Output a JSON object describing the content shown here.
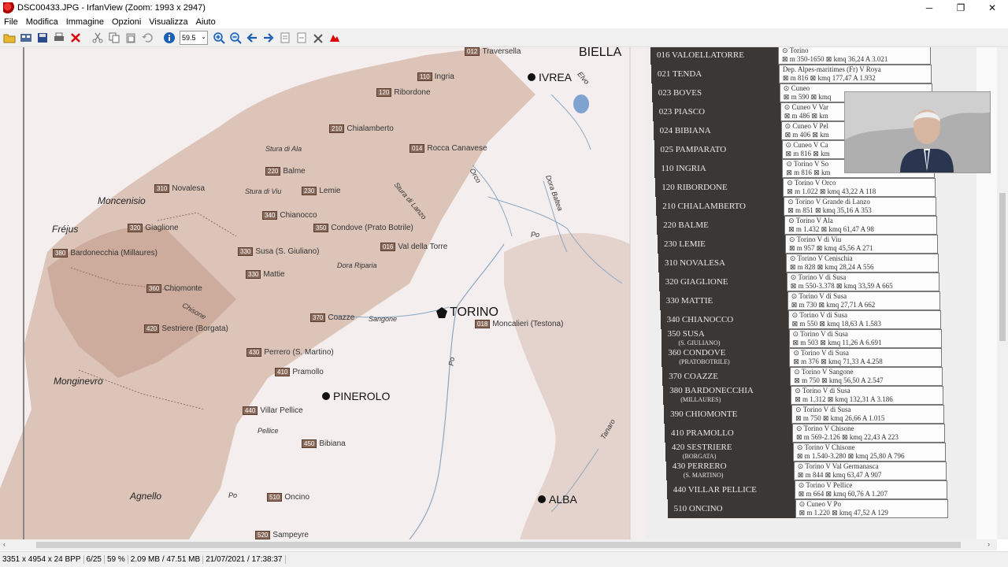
{
  "window": {
    "title": "DSC00433.JPG - IrfanView (Zoom: 1993 x 2947)",
    "minimize": "─",
    "maximize": "❐",
    "close": "✕"
  },
  "menu": [
    "File",
    "Modifica",
    "Immagine",
    "Opzioni",
    "Visualizza",
    "Aiuto"
  ],
  "toolbar": {
    "zoom_value": "59.5"
  },
  "status": [
    "3351 x 4954 x 24 BPP",
    "6/25",
    "59 %",
    "2.09 MB / 47.51 MB",
    "21/07/2021 / 17:38:37"
  ],
  "map": {
    "cities": [
      "BIELLA",
      "IVREA",
      "TORINO",
      "PINEROLO",
      "ALBA"
    ],
    "passes": [
      "Moncenisio",
      "Fréjus",
      "Monginevro",
      "Agnello"
    ],
    "rivers": [
      "Stura di Ala",
      "Stura di Viu",
      "Stura di Lanzo",
      "Orco",
      "Dora Baltea",
      "Po",
      "Dora Riparia",
      "Sangone",
      "Chisone",
      "Pellice",
      "Tanaro",
      "Po",
      "Po",
      "Elvo"
    ],
    "labels": [
      {
        "code": "012",
        "name": "Traversella"
      },
      {
        "code": "110",
        "name": "Ingria"
      },
      {
        "code": "120",
        "name": "Ribordone"
      },
      {
        "code": "210",
        "name": "Chialamberto"
      },
      {
        "code": "014",
        "name": "Rocca Canavese"
      },
      {
        "code": "220",
        "name": "Balme"
      },
      {
        "code": "310",
        "name": "Novalesa"
      },
      {
        "code": "230",
        "name": "Lemie"
      },
      {
        "code": "340",
        "name": "Chianocco"
      },
      {
        "code": "320",
        "name": "Giaglione"
      },
      {
        "code": "350",
        "name": "Condove (Prato Botrile)"
      },
      {
        "code": "380",
        "name": "Bardonecchia (Millaures)"
      },
      {
        "code": "330",
        "name": "Susa (S. Giuliano)"
      },
      {
        "code": "016",
        "name": "Val della Torre"
      },
      {
        "code": "330",
        "name": "Mattie"
      },
      {
        "code": "360",
        "name": "Chiomonte"
      },
      {
        "code": "370",
        "name": "Coazze"
      },
      {
        "code": "018",
        "name": "Moncalieri (Testona)"
      },
      {
        "code": "420",
        "name": "Sestriere (Borgata)"
      },
      {
        "code": "430",
        "name": "Perrero (S. Martino)"
      },
      {
        "code": "410",
        "name": "Pramollo"
      },
      {
        "code": "440",
        "name": "Villar Pellice"
      },
      {
        "code": "450",
        "name": "Bibiana"
      },
      {
        "code": "510",
        "name": "Oncino"
      },
      {
        "code": "520",
        "name": "Sampeyre"
      }
    ]
  },
  "table": [
    {
      "name": "016 VALOELLATORRE",
      "l1": "⊙ Torino",
      "l2": "⊠ m 350-1650 ⊠ kmq 36,24 A 3.021"
    },
    {
      "name": "021 TENDA",
      "l1": "Dep. Alpes-maritimes (Fr) V Roya",
      "l2": "⊠ m 816 ⊠ kmq 177,47 A 1.932"
    },
    {
      "name": "023 BOVES",
      "l1": "⊙ Cuneo",
      "l2": "⊠ m 590 ⊠ kmq"
    },
    {
      "name": "023 PIASCO",
      "l1": "⊙ Cuneo V Var",
      "l2": "⊠ m 486 ⊠ km"
    },
    {
      "name": "024 BIBIANA",
      "l1": "⊙ Cuneo V Pel",
      "l2": "⊠ m 406 ⊠ km"
    },
    {
      "name": "025 PAMPARATO",
      "l1": "⊙ Cuneo V Ca",
      "l2": "⊠ m 816 ⊠ km"
    },
    {
      "name": "110 INGRIA",
      "l1": "⊙ Torino V So",
      "l2": "⊠ m 816 ⊠ km"
    },
    {
      "name": "120 RIBORDONE",
      "l1": "⊙ Torino V Orco",
      "l2": "⊠ m 1.022 ⊠ kmq 43,22 A 118"
    },
    {
      "name": "210 CHIALAMBERTO",
      "l1": "⊙ Torino V Grande di Lanzo",
      "l2": "⊠ m 851 ⊠ kmq 35,16 A 353"
    },
    {
      "name": "220 BALME",
      "l1": "⊙ Torino V Ala",
      "l2": "⊠ m 1.432 ⊠ kmq 61,47 A 98"
    },
    {
      "name": "230 LEMIE",
      "l1": "⊙ Torino V di Viu",
      "l2": "⊠ m 957 ⊠ kmq 45,56 A 271"
    },
    {
      "name": "310 NOVALESA",
      "l1": "⊙ Torino V Cenischia",
      "l2": "⊠ m 828 ⊠ kmq 28,24 A 556"
    },
    {
      "name": "320 GIAGLIONE",
      "l1": "⊙ Torino V di Susa",
      "l2": "⊠ m 550-3.378 ⊠ kmq 33,59 A 665"
    },
    {
      "name": "330 MATTIE",
      "l1": "⊙ Torino V di Susa",
      "l2": "⊠ m 730 ⊠ kmq 27,71 A 662"
    },
    {
      "name": "340 CHIANOCCO",
      "l1": "⊙ Torino V di Susa",
      "l2": "⊠ m 550 ⊠ kmq 18,63 A 1.583"
    },
    {
      "name": "350 SUSA",
      "sub": "(S. GIULIANO)",
      "l1": "⊙ Torino V di Susa",
      "l2": "⊠ m 503 ⊠ kmq 11,26 A 6.691"
    },
    {
      "name": "360 CONDOVE",
      "sub": "(PRATOBOTRILE)",
      "l1": "⊙ Torino V di Susa",
      "l2": "⊠ m 376 ⊠ kmq 71,33 A 4.258"
    },
    {
      "name": "370 COAZZE",
      "l1": "⊙ Torino V Sangone",
      "l2": "⊠ m 750 ⊠ kmq 56,50 A 2.547"
    },
    {
      "name": "380 BARDONECCHIA",
      "sub": "(MILLAURES)",
      "l1": "⊙ Torino V di Susa",
      "l2": "⊠ m 1.312 ⊠ kmq 132,31 A 3.186"
    },
    {
      "name": "390 CHIOMONTE",
      "l1": "⊙ Torino V di Susa",
      "l2": "⊠ m 750 ⊠ kmq 26,66 A 1.015"
    },
    {
      "name": "410 PRAMOLLO",
      "l1": "⊙ Torino V Chisone",
      "l2": "⊠ m 569-2.126 ⊠ kmq 22,43 A 223"
    },
    {
      "name": "420 SESTRIERE",
      "sub": "(BORGATA)",
      "l1": "⊙ Torino V Chisone",
      "l2": "⊠ m 1.540-3.280 ⊠ kmq 25,80 A 796"
    },
    {
      "name": "430 PERRERO",
      "sub": "(S. MARTINO)",
      "l1": "⊙ Torino V Val Germanasca",
      "l2": "⊠ m 844 ⊠ kmq 63,47 A 907"
    },
    {
      "name": "440 VILLAR PELLICE",
      "l1": "⊙ Torino V Pellice",
      "l2": "⊠ m 664 ⊠ kmq 60,76 A 1.207"
    },
    {
      "name": "510 ONCINO",
      "l1": "⊙ Cuneo V Po",
      "l2": "⊠ m 1.220 ⊠ kmq 47,52 A 129"
    }
  ]
}
